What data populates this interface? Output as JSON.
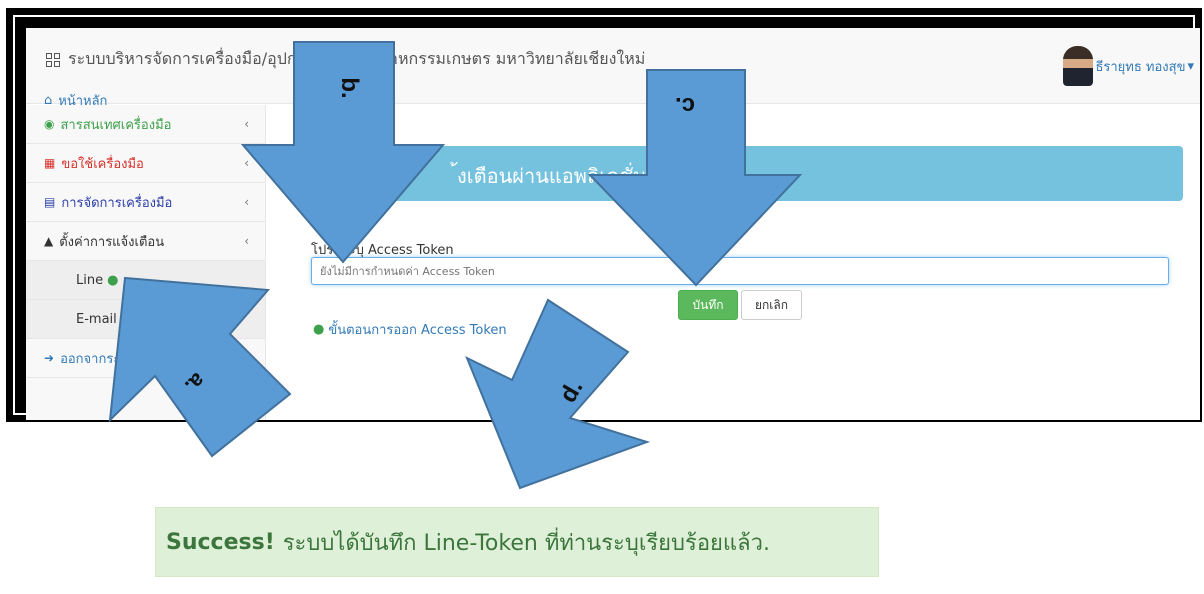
{
  "app": {
    "title": "ระบบบริหารจัดการเครื่องมือ/อุปกรณ์ คณะอุตสาหกรรมเกษตร มหาวิทยาลัยเชียงใหม่",
    "user_name": "ธีรายุทธ ทองสุข",
    "user_caret": "▾"
  },
  "nav": {
    "home_label": "หน้าหลัก"
  },
  "sidebar": {
    "items": [
      {
        "label": "สารสนเทศเครื่องมือ",
        "color": "#3ca14a"
      },
      {
        "label": "ขอใช้เครื่องมือ",
        "color": "#d9312b"
      },
      {
        "label": "การจัดการเครื่องมือ",
        "color": "#2b3ea8"
      },
      {
        "label": "ตั้งค่าการแจ้งเตือน",
        "color": "#333333"
      },
      {
        "label": "Line"
      },
      {
        "label": "E-mail"
      },
      {
        "label": "ออกจากระบบ"
      }
    ],
    "caret": "‹"
  },
  "panel": {
    "title_visible": "้งเตือนผ่านแอพลิเคชั่น LI",
    "field_label": "โปรดระบุ Access Token",
    "placeholder": "ยังไม่มีการกำหนดค่า Access Token",
    "save_label": "บันทึก",
    "cancel_label": "ยกเลิก",
    "steps_link": "ขั้นตอนการออก Access Token"
  },
  "success": {
    "strong": "Success!",
    "message": "ระบบได้บันทึก Line-Token ที่ท่านระบุเรียบร้อยแล้ว."
  },
  "callouts": {
    "a": "a.",
    "b": "b.",
    "c": "c.",
    "d": "d."
  },
  "colors": {
    "arrow": "#5b9bd5",
    "arrow_border": "#41719c",
    "success_bg": "#dff0d8",
    "save": "#5cb85c",
    "panel": "#75c2de"
  }
}
